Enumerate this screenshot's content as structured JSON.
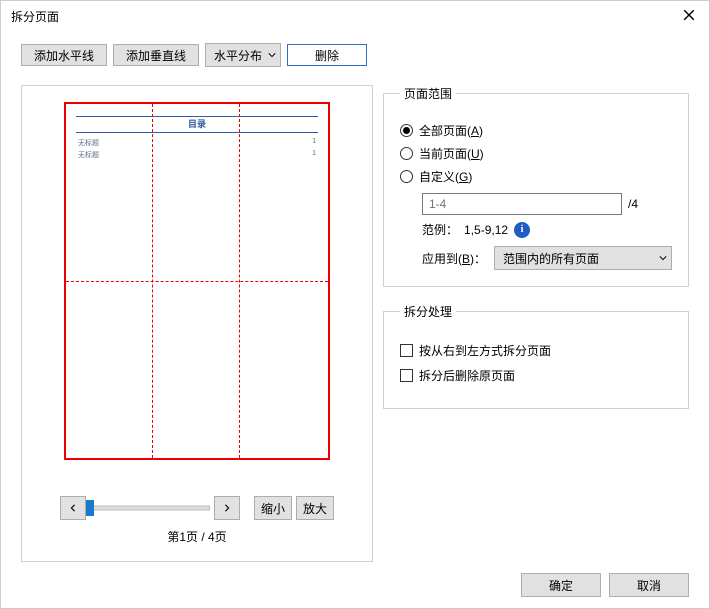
{
  "title": "拆分页面",
  "toolbar": {
    "add_h": "添加水平线",
    "add_v": "添加垂直线",
    "distribute": "水平分布",
    "delete": "删除"
  },
  "preview": {
    "heading": "目录",
    "rows": [
      {
        "label": "无标题",
        "page": "1"
      },
      {
        "label": "无标题",
        "page": "1"
      }
    ],
    "page_indicator": "第1页 / 4页",
    "zoom_out": "缩小",
    "zoom_in": "放大"
  },
  "range": {
    "legend": "页面范围",
    "all_prefix": "全部页面(",
    "all_key": "A",
    "current_prefix": "当前页面(",
    "current_key": "U",
    "custom_prefix": "自定义(",
    "custom_key": "G",
    "close_paren": ")",
    "range_placeholder": "1-4",
    "total_suffix": "/4",
    "example_label": "范例：",
    "example_value": "1,5-9,12",
    "apply_prefix": "应用到(",
    "apply_key": "B",
    "apply_close": ")：",
    "apply_value": "范围内的所有页面"
  },
  "process": {
    "legend": "拆分处理",
    "rtl_split": "按从右到左方式拆分页面",
    "delete_after": "拆分后删除原页面"
  },
  "footer": {
    "ok": "确定",
    "cancel": "取消"
  }
}
